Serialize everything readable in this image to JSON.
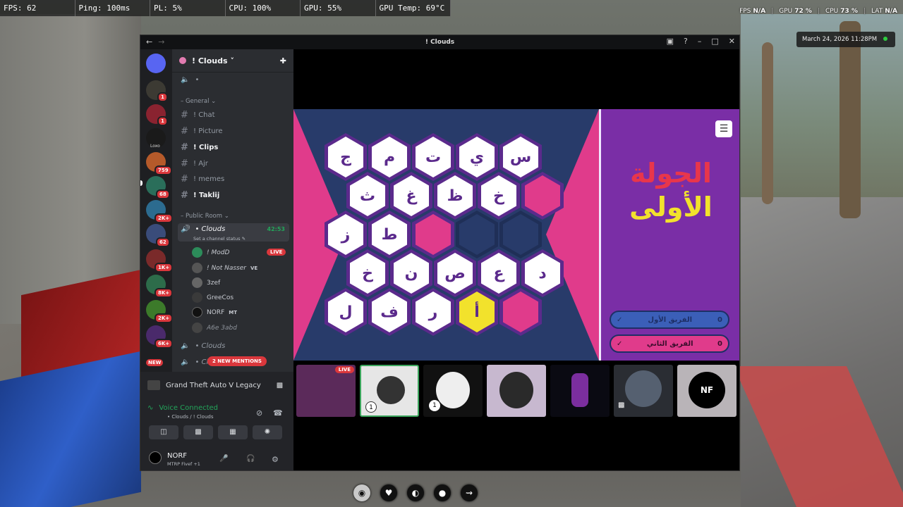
{
  "perf": {
    "fps": "FPS: 62",
    "ping": "Ping: 100ms",
    "pl": "PL: 5%",
    "cpu": "CPU: 100%",
    "gpu": "GPU: 55%",
    "gpu_temp": "GPU Temp: 69°C"
  },
  "perf_right": {
    "fps_label": "FPS",
    "fps_value": "N/A",
    "gpu_label": "GPU",
    "gpu_value": "72 %",
    "cpu_label": "CPU",
    "cpu_value": "73 %",
    "lat_label": "LAT",
    "lat_value": "N/A"
  },
  "datetime": "March 24, 2026 11:28PM",
  "window": {
    "title": "! Clouds",
    "guild_name": "! Clouds",
    "voice_stub": "•",
    "categories": {
      "general": "General",
      "public": "Public Room"
    },
    "channels": [
      {
        "name": "! Chat",
        "unread": false
      },
      {
        "name": "! Picture",
        "unread": false
      },
      {
        "name": "! Clips",
        "unread": true
      },
      {
        "name": "! Ajr",
        "unread": false
      },
      {
        "name": "! memes",
        "unread": false
      },
      {
        "name": "! Taklij",
        "unread": true
      }
    ],
    "voice_channel": {
      "name": "• Clouds",
      "timer": "42:53",
      "status": "Set a channel status",
      "members": [
        {
          "name": "! ModD",
          "tag": "LIVE"
        },
        {
          "name": "! Not Nasser",
          "tag": "VE"
        },
        {
          "name": "3zef",
          "tag": ""
        },
        {
          "name": "GreeCos",
          "tag": ""
        },
        {
          "name": "NORF",
          "tag": "MT"
        },
        {
          "name": "A6e 3abd",
          "tag": ""
        }
      ]
    },
    "other_voice": [
      "• Clouds",
      "• Cl"
    ],
    "mentions": "2 NEW MENTIONS",
    "new_badge": "NEW",
    "server_badges": [
      "1",
      "1",
      "759",
      "68",
      "2K+",
      "62",
      "1K+",
      "8K+",
      "2K+",
      "6K+"
    ],
    "server_label_loxo": "Loxo",
    "activity": "Grand Theft Auto V Legacy",
    "voice_connected": "Voice Connected",
    "voice_location": "• Clouds / ! Clouds",
    "user_name": "NORF",
    "user_status": "MTRP Fivef +1"
  },
  "game": {
    "round_line1": "الجولة",
    "round_line2": "الأولى",
    "team1": "الفريق الأول",
    "team1_score": "0",
    "team2": "الفريق الثاني",
    "team2_score": "0",
    "hex_letters": {
      "r1": [
        "ج",
        "م",
        "ت",
        "ي",
        "س"
      ],
      "r2": [
        "ث",
        "غ",
        "ظ",
        "خ",
        ""
      ],
      "r3": [
        "ز",
        "ط",
        "",
        "",
        ""
      ],
      "r4": [
        "خ",
        "ن",
        "ص",
        "ع",
        "د"
      ],
      "r5": [
        "ل",
        "ف",
        "ر",
        "أ",
        ""
      ]
    }
  },
  "thumbs": {
    "live": "LIVE",
    "num1": "1",
    "num2": "1"
  },
  "colors": {
    "board_navy": "#283b6a",
    "pink": "#e03b8b",
    "purple": "#7a2ea6",
    "yellow": "#f2e22c",
    "red_title": "#e8364b"
  }
}
